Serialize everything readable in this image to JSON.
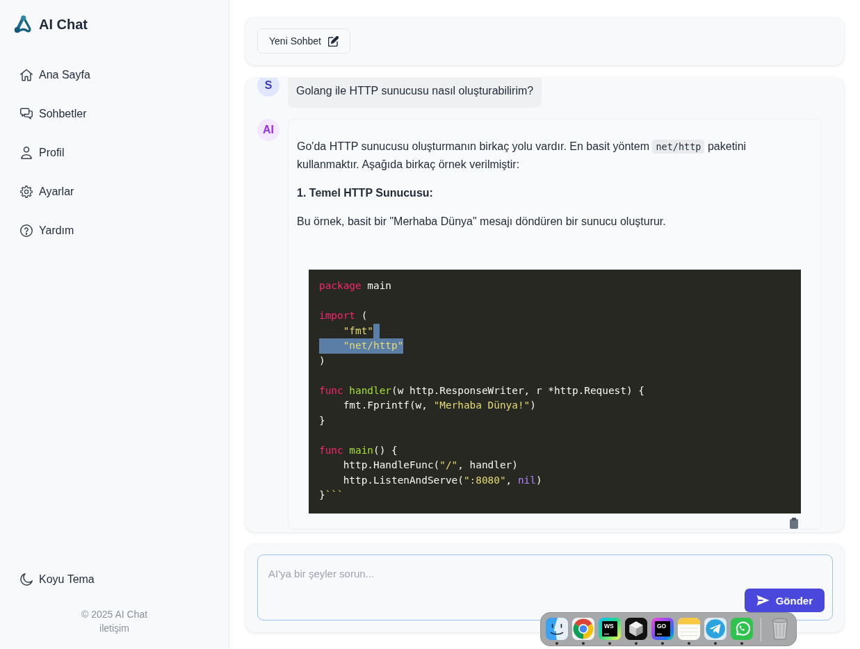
{
  "sidebar": {
    "logo": {
      "title": "AI Chat"
    },
    "nav_items": [
      {
        "label": "Ana Sayfa"
      },
      {
        "label": "Sohbetler"
      },
      {
        "label": "Profil"
      },
      {
        "label": "Ayarlar"
      },
      {
        "label": "Yardım"
      }
    ],
    "theme_toggle": {
      "label": "Koyu Tema"
    },
    "footer": {
      "copyright": "© 2025 AI Chat",
      "link": "iletişim"
    }
  },
  "toolbar": {
    "new_chat_button": {
      "label": "Yeni Sohbet"
    }
  },
  "messages": [
    {
      "kind": "user",
      "avatar": "S",
      "text": "Golang ile HTTP sunucusu nasıl oluşturabilirim?"
    },
    {
      "kind": "assistant",
      "avatar": "AI",
      "blocks": [
        {
          "kind": "paragraph",
          "parts": [
            {
              "kind": "text",
              "text": "Go'da HTTP sunucusu oluşturmanın birkaç yolu vardır. En basit yöntem "
            },
            {
              "kind": "code",
              "text": "net/http"
            },
            {
              "kind": "text",
              "text": " paketini kullanmaktır. Aşağıda birkaç örnek verilmiştir:"
            }
          ]
        },
        {
          "kind": "heading",
          "text": "1. Temel HTTP Sunucusu:"
        },
        {
          "kind": "paragraph",
          "parts": [
            {
              "kind": "text",
              "text": "Bu örnek, basit bir \"Merhaba Dünya\" mesajı döndüren bir sunucu oluşturur."
            }
          ]
        },
        {
          "kind": "code",
          "groups": [
            {
              "lines": [
                {
                  "selected": false,
                  "break_selected": false,
                  "tokens": [
                    {
                      "kind": "keyword",
                      "text": "package"
                    },
                    {
                      "kind": "plain",
                      "text": " main"
                    }
                  ]
                }
              ]
            },
            {
              "lines": [
                {
                  "selected": false,
                  "break_selected": false,
                  "tokens": [
                    {
                      "kind": "keyword",
                      "text": "import"
                    },
                    {
                      "kind": "plain",
                      "text": " ("
                    }
                  ]
                },
                {
                  "selected": false,
                  "break_selected": true,
                  "tokens": [
                    {
                      "kind": "string",
                      "text": "    \"fmt\""
                    }
                  ]
                },
                {
                  "selected": true,
                  "break_selected": false,
                  "tokens": [
                    {
                      "kind": "string",
                      "text": "    \"net/http\""
                    }
                  ]
                },
                {
                  "selected": false,
                  "break_selected": false,
                  "tokens": [
                    {
                      "kind": "plain",
                      "text": ")"
                    }
                  ]
                }
              ]
            },
            {
              "lines": [
                {
                  "selected": false,
                  "break_selected": false,
                  "tokens": [
                    {
                      "kind": "keyword",
                      "text": "func "
                    },
                    {
                      "kind": "function",
                      "text": "handler"
                    },
                    {
                      "kind": "plain",
                      "text": "(w http.ResponseWriter, r *http.Request) {"
                    }
                  ]
                },
                {
                  "selected": false,
                  "break_selected": false,
                  "tokens": [
                    {
                      "kind": "plain",
                      "text": "    fmt.Fprintf(w, "
                    },
                    {
                      "kind": "string",
                      "text": "\"Merhaba Dünya!\""
                    },
                    {
                      "kind": "plain",
                      "text": ")"
                    }
                  ]
                },
                {
                  "selected": false,
                  "break_selected": false,
                  "tokens": [
                    {
                      "kind": "plain",
                      "text": "}"
                    }
                  ]
                }
              ]
            },
            {
              "lines": [
                {
                  "selected": false,
                  "break_selected": false,
                  "tokens": [
                    {
                      "kind": "keyword",
                      "text": "func "
                    },
                    {
                      "kind": "function",
                      "text": "main"
                    },
                    {
                      "kind": "plain",
                      "text": "() {"
                    }
                  ]
                },
                {
                  "selected": false,
                  "break_selected": false,
                  "tokens": [
                    {
                      "kind": "plain",
                      "text": "    http.HandleFunc("
                    },
                    {
                      "kind": "string",
                      "text": "\"/\""
                    },
                    {
                      "kind": "plain",
                      "text": ", handler)"
                    }
                  ]
                },
                {
                  "selected": false,
                  "break_selected": false,
                  "tokens": [
                    {
                      "kind": "plain",
                      "text": "    http.ListenAndServe("
                    },
                    {
                      "kind": "string",
                      "text": "\":8080\""
                    },
                    {
                      "kind": "plain",
                      "text": ", "
                    },
                    {
                      "kind": "constant",
                      "text": "nil"
                    },
                    {
                      "kind": "plain",
                      "text": ")"
                    }
                  ]
                },
                {
                  "selected": false,
                  "break_selected": false,
                  "tokens": [
                    {
                      "kind": "plain",
                      "text": "}"
                    },
                    {
                      "kind": "string",
                      "text": "```"
                    }
                  ]
                }
              ]
            }
          ]
        }
      ]
    }
  ],
  "composer": {
    "placeholder": "AI'ya bir şeyler sorun...",
    "send_button": {
      "label": "Gönder"
    }
  },
  "dock": {
    "items": [
      {
        "kind": "app",
        "running": true
      },
      {
        "kind": "app",
        "running": true
      },
      {
        "kind": "text_tile",
        "label": "WS",
        "running": true
      },
      {
        "kind": "app",
        "running": true
      },
      {
        "kind": "text_tile",
        "label": "GO",
        "running": true
      },
      {
        "kind": "app",
        "running": true
      },
      {
        "kind": "app",
        "running": true
      },
      {
        "kind": "app",
        "running": true
      },
      {
        "kind": "trash",
        "running": false
      }
    ]
  }
}
